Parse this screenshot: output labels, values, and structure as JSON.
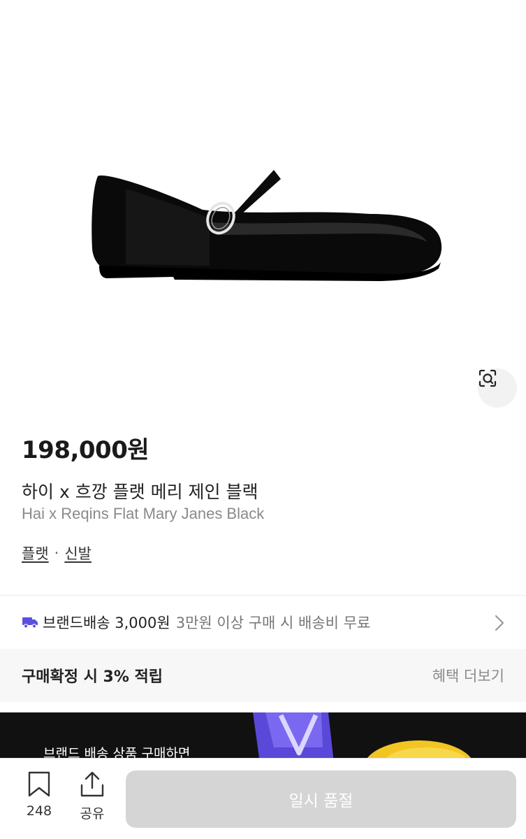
{
  "product": {
    "image_alt_icon": "shoe-image",
    "price": "198,000원",
    "name_ko": "하이 x 흐깡 플랫 메리 제인 블랙",
    "name_en": "Hai x Reqins Flat Mary Janes Black",
    "categories": [
      "플랫",
      "신발"
    ],
    "separator": "·"
  },
  "shipping": {
    "label": "브랜드배송 3,000원",
    "sub": "3만원 이상 구매 시 배송비 무료"
  },
  "reward": {
    "text": "구매확정 시 3% 적립",
    "more": "혜택 더보기"
  },
  "banner": {
    "text": "브랜드 배송 상품 구매하면"
  },
  "bottom_bar": {
    "bookmark_count": "248",
    "share_label": "공유",
    "cta_label": "일시 품절"
  },
  "colors": {
    "accent": "#5b4fe0",
    "disabled_button": "#d5d5d5",
    "sub_text": "#8a8a8a"
  }
}
